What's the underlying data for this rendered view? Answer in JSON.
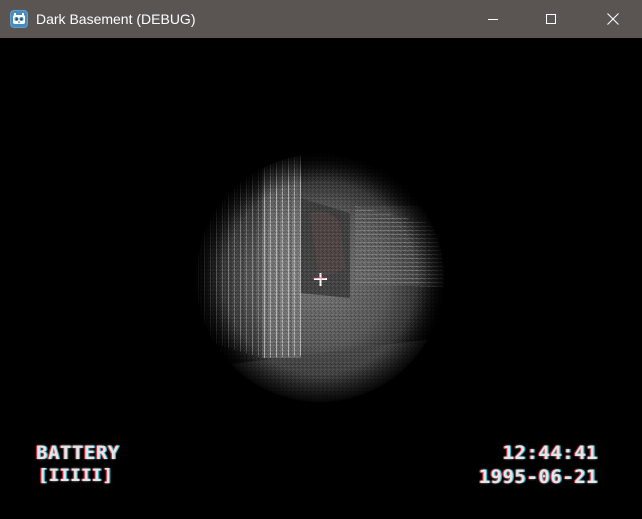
{
  "window": {
    "title": "Dark Basement (DEBUG)",
    "app_icon": "godot-engine-icon",
    "controls": {
      "minimize": "minimize-icon",
      "maximize": "maximize-icon",
      "close": "close-icon"
    },
    "titlebar_color": "#5a5552"
  },
  "hud": {
    "battery_label": "BATTERY",
    "battery_bar": "[IIIII]",
    "time": "12:44:41",
    "date": "1995-06-21"
  },
  "scene": {
    "style": "night-vision-flashlight",
    "crosshair": "crosshair-icon"
  },
  "colors": {
    "background": "#000000",
    "hud_text": "#e6e6e6",
    "chromatic_red": "#ff283c",
    "chromatic_cyan": "#28dcff"
  }
}
